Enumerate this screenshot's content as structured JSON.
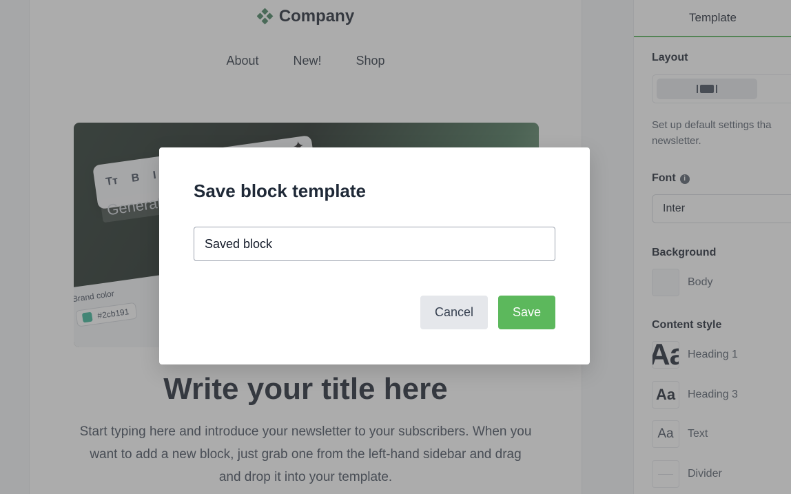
{
  "email": {
    "brand_name": "Company",
    "nav": [
      "About",
      "New!",
      "Shop"
    ],
    "hero": {
      "tools": [
        "Tт",
        "B",
        "I"
      ],
      "generate_text": "Generate",
      "brand_color_label": "Brand color",
      "brand_color_value": "#2cb191"
    },
    "title": "Write your title here",
    "intro": "Start typing here and introduce your newsletter to your subscribers. When you want to add a new block, just grab one from the left-hand sidebar and drag and drop it into your template."
  },
  "panel": {
    "tab": "Template",
    "layout_label": "Layout",
    "description": "Set up default settings tha newsletter.",
    "font_label": "Font",
    "font_value": "Inter",
    "background_label": "Background",
    "background_item": "Body",
    "content_style_label": "Content style",
    "styles": [
      {
        "preview": "Aa",
        "label": "Heading 1"
      },
      {
        "preview": "Aa",
        "label": "Heading 3"
      },
      {
        "preview": "Aa",
        "label": "Text"
      },
      {
        "preview": "",
        "label": "Divider"
      }
    ]
  },
  "modal": {
    "title": "Save block template",
    "input_value": "Saved block",
    "cancel_label": "Cancel",
    "save_label": "Save"
  },
  "colors": {
    "accent": "#5cb85c",
    "tab_underline": "#4caf50",
    "brand_swatch": "#2cb191"
  },
  "icons": {
    "brand_logo": "diamond-grid-icon",
    "font_info": "info-icon",
    "hero_sparkle": "sparkle-icon"
  }
}
